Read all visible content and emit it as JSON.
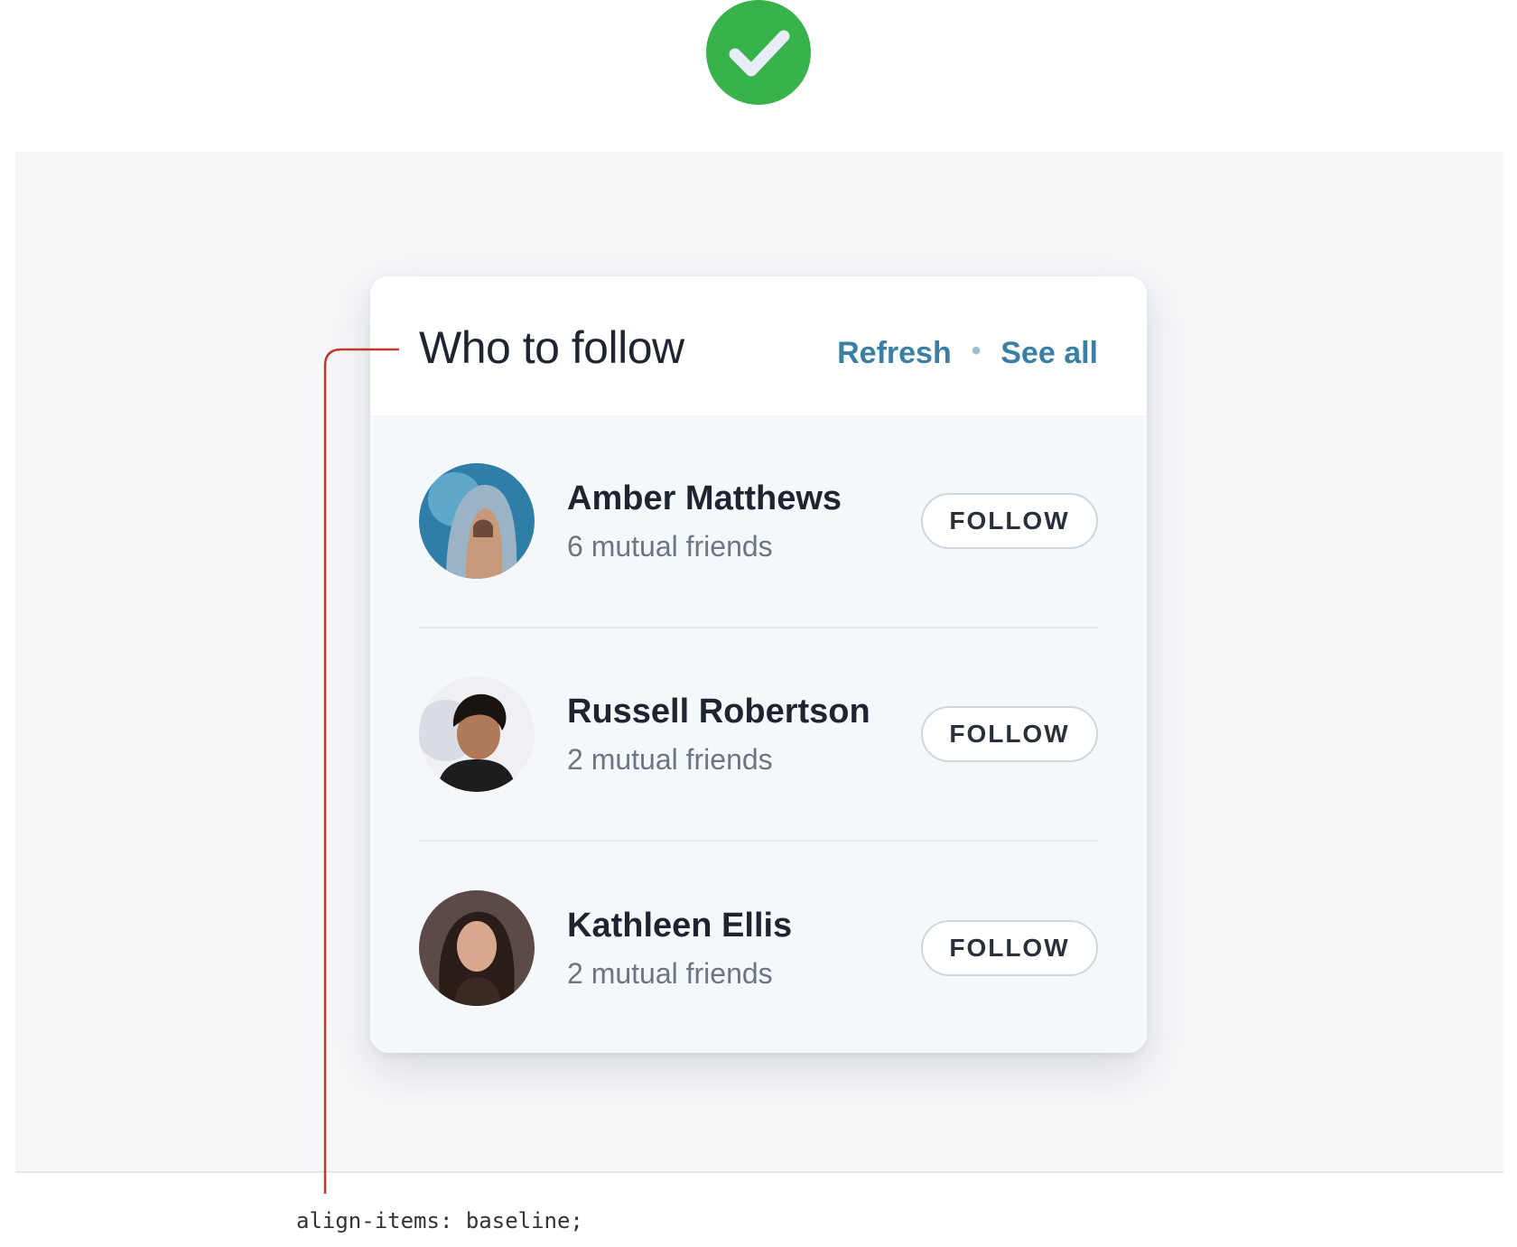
{
  "card": {
    "title": "Who to follow",
    "links": {
      "refresh": "Refresh",
      "separator": "•",
      "see_all": "See all"
    },
    "people": [
      {
        "name": "Amber Matthews",
        "meta": "6 mutual friends",
        "button": "FOLLOW",
        "avatar": "hooded-woman-avatar"
      },
      {
        "name": "Russell Robertson",
        "meta": "2 mutual friends",
        "button": "FOLLOW",
        "avatar": "curly-hair-man-avatar"
      },
      {
        "name": "Kathleen Ellis",
        "meta": "2 mutual friends",
        "button": "FOLLOW",
        "avatar": "long-hair-woman-avatar"
      }
    ]
  },
  "annotation": {
    "code": "align-items: baseline;"
  },
  "colors": {
    "success_badge": "#38b24a",
    "link": "#3a7fa6",
    "callout": "#c0392b"
  },
  "icons": {
    "badge": "check-icon"
  }
}
